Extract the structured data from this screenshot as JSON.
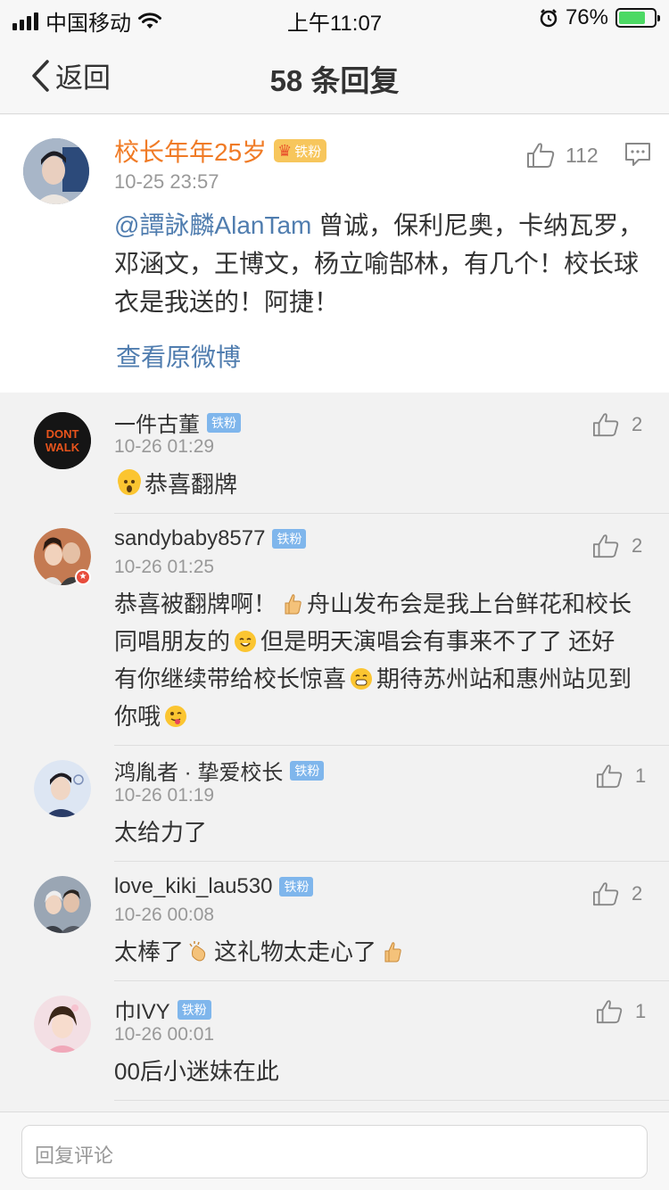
{
  "status_bar": {
    "carrier": "中国移动",
    "time": "上午11:07",
    "battery": "76%",
    "battery_level": 0.76
  },
  "nav": {
    "back_label": "返回",
    "title": "58 条回复"
  },
  "main_post": {
    "author": "校长年年25岁",
    "badge": "铁粉",
    "time": "10-25 23:57",
    "like_count": "112",
    "mention": "@譚詠麟AlanTam",
    "text": " 曾诚，保利尼奥，卡纳瓦罗，邓涵文，王博文，杨立喻郜林，有几个！校长球衣是我送的！阿捷！",
    "view_original": "查看原微博"
  },
  "replies": [
    {
      "author": "一件古董",
      "badge": "铁粉",
      "time": "10-26 01:29",
      "text": "恭喜翻牌",
      "likes": "2"
    },
    {
      "author": "sandybaby8577",
      "badge": "铁粉",
      "time": "10-26 01:25",
      "text_1": "恭喜被翻牌啊！",
      "text_2": "舟山发布会是我上台鲜花和校长同唱朋友的",
      "text_3": "但是明天演唱会有事来不了了 还好有你继续带给校长惊喜",
      "text_4": "期待苏州站和惠州站见到你哦",
      "likes": "2"
    },
    {
      "author": "鸿胤者 · 挚爱校长",
      "badge": "铁粉",
      "time": "10-26 01:19",
      "text": "太给力了",
      "likes": "1"
    },
    {
      "author": "love_kiki_lau530",
      "badge": "铁粉",
      "time": "10-26 00:08",
      "text_1": "太棒了",
      "text_2": "这礼物太走心了",
      "likes": "2"
    },
    {
      "author": "巾IVY",
      "badge": "铁粉",
      "time": "10-26 00:01",
      "text": "00后小迷妹在此",
      "likes": "1"
    }
  ],
  "avatar_texts": {
    "dont_walk_1": "DONT",
    "dont_walk_2": "WALK"
  },
  "input": {
    "placeholder": "回复评论"
  },
  "colors": {
    "accent_link": "#507daf",
    "author_orange": "#f07b26",
    "fan_badge": "#7fb6ec"
  }
}
